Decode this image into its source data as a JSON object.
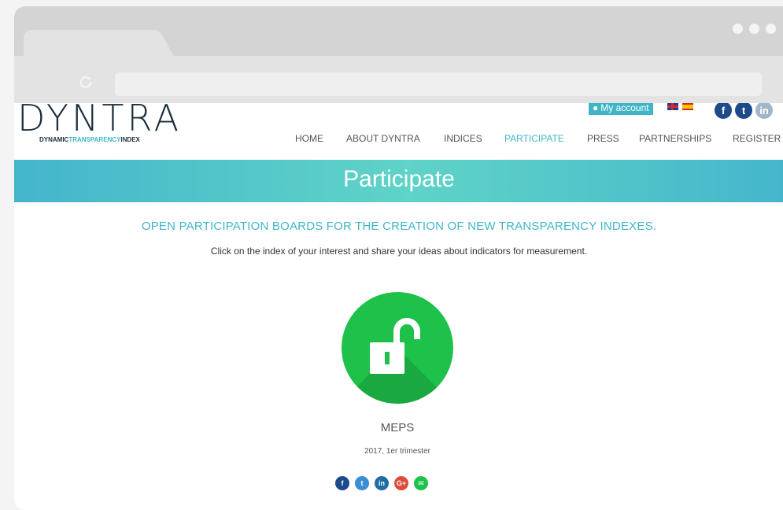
{
  "brand": {
    "logo_text": "DYNTRA",
    "logo_sub_1": "DYNAMIC",
    "logo_sub_2": "TRANSPARENCY",
    "logo_sub_3": "INDEX",
    "accent_color": "#3fb6c8"
  },
  "utility": {
    "account_label": "My account",
    "languages": [
      "en-flag",
      "es-flag"
    ],
    "social": [
      "facebook-icon",
      "twitter-icon",
      "linkedin-icon"
    ]
  },
  "nav": {
    "items": [
      {
        "label": "HOME"
      },
      {
        "label": "ABOUT DYNTRA"
      },
      {
        "label": "INDICES"
      },
      {
        "label": "PARTICIPATE"
      },
      {
        "label": "PRESS"
      },
      {
        "label": "PARTNERSHIPS"
      },
      {
        "label": "REGISTER"
      }
    ],
    "active": "PARTICIPATE"
  },
  "banner": {
    "title": "Participate"
  },
  "content": {
    "headline": "OPEN PARTICIPATION BOARDS FOR THE CREATION OF NEW TRANSPARENCY INDEXES.",
    "subline": "Click on the index of your interest and share your ideas about indicators for measurement."
  },
  "index": {
    "icon": "unlocked-padlock-icon",
    "color": "#1ec14a",
    "name": "MEPS",
    "period": "2017, 1er trimester",
    "share": [
      {
        "icon": "facebook-icon",
        "glyph": "f",
        "color": "#1c4a8a"
      },
      {
        "icon": "twitter-icon",
        "glyph": "t",
        "color": "#3a8fd4"
      },
      {
        "icon": "linkedin-icon",
        "glyph": "in",
        "color": "#1c6ea4"
      },
      {
        "icon": "googleplus-icon",
        "glyph": "G+",
        "color": "#dd4b39"
      },
      {
        "icon": "email-icon",
        "glyph": "✉",
        "color": "#1ec14a"
      }
    ]
  }
}
